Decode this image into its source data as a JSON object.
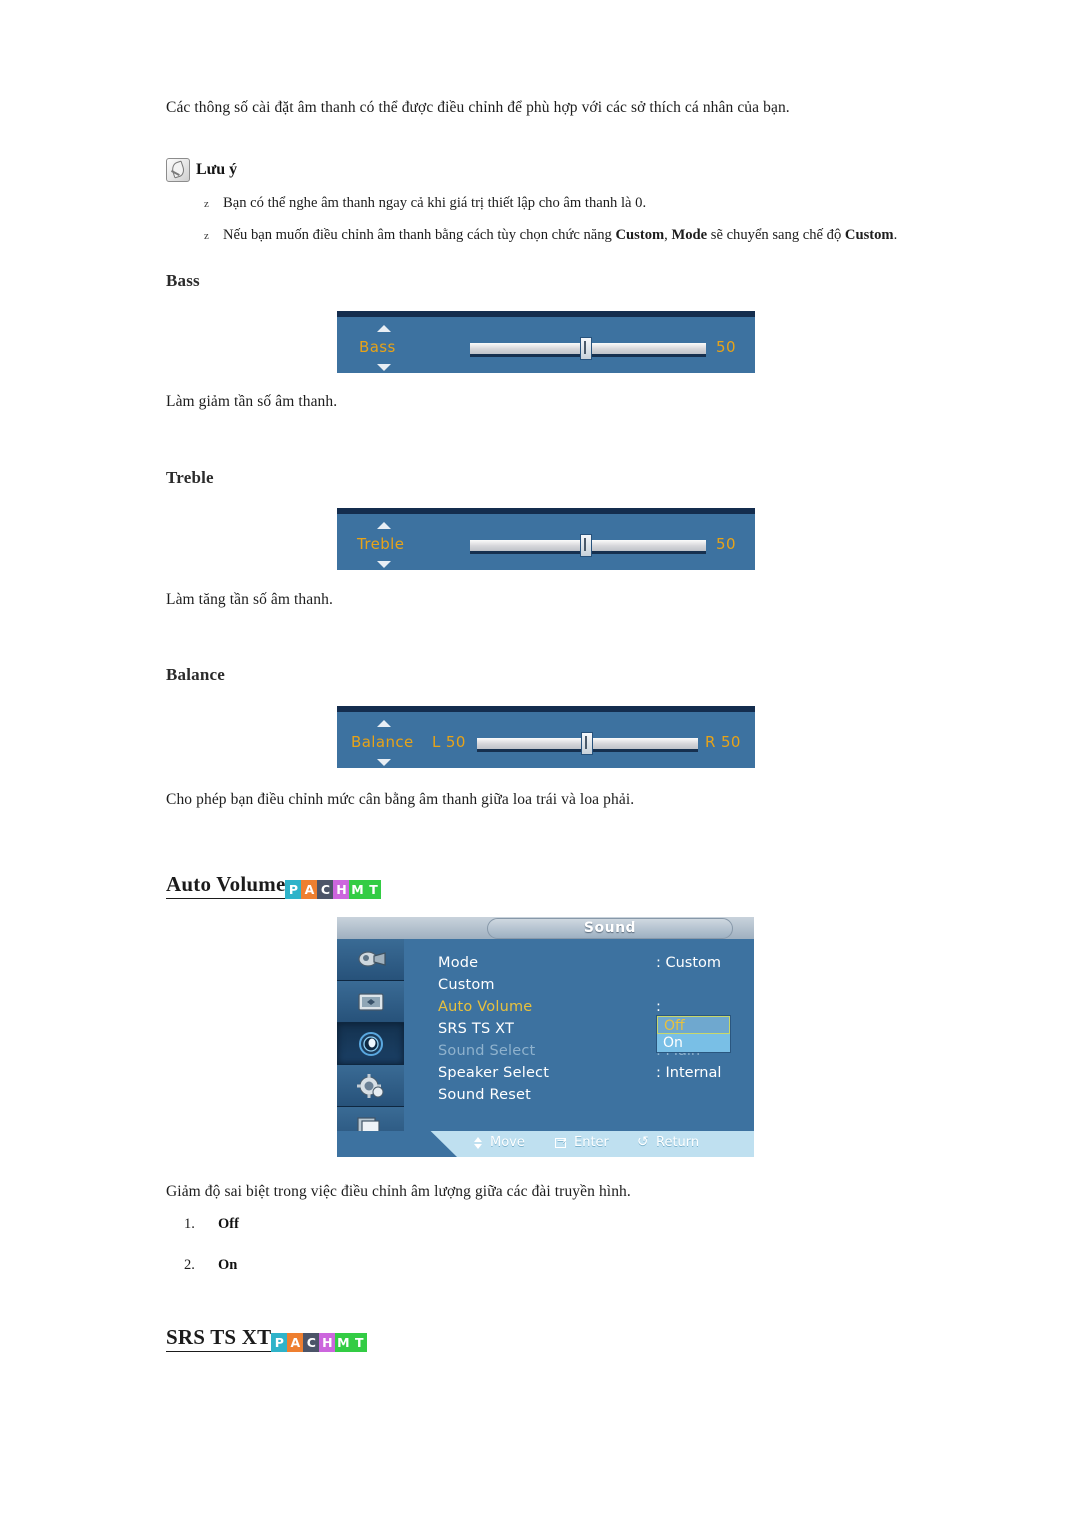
{
  "intro": "Các thông số cài đặt âm thanh có thể được điều chỉnh để phù hợp với các sở thích cá nhân của bạn.",
  "note": {
    "title": "Lưu ý",
    "bullet_marker": "z",
    "items": [
      {
        "pre": "Bạn có thể nghe âm thanh ngay cả khi giá trị thiết lập cho âm thanh là 0.",
        "parts": []
      },
      {
        "pre": "Nếu bạn muốn điều chỉnh âm thanh bằng cách tùy chọn chức năng ",
        "bold1": "Custom",
        "mid": ", ",
        "bold2": "Mode",
        "mid2": " sẽ chuyển sang chế độ ",
        "bold3": "Custom",
        "post": "."
      }
    ]
  },
  "sections": [
    {
      "heading": "Bass",
      "osd_label": "Bass",
      "value": "50",
      "description": "Làm giảm tần số âm thanh."
    },
    {
      "heading": "Treble",
      "osd_label": "Treble",
      "value": "50",
      "description": "Làm tăng tần số âm thanh."
    },
    {
      "heading": "Balance",
      "osd_label": "Balance",
      "left_label": "L  50",
      "right_label": "R  50",
      "description": "Cho phép bạn điều chỉnh mức cân bằng âm thanh giữa loa trái và loa phải."
    }
  ],
  "badge": {
    "letters": [
      "P",
      "A",
      "C",
      "H",
      "M",
      "T"
    ],
    "colors": [
      "#2fb3c9",
      "#ee7f30",
      "#4c5468",
      "#cc66dd",
      "#33cc44",
      "#33cc44"
    ]
  },
  "auto_volume": {
    "heading": "Auto Volume",
    "description": "Giảm độ sai biệt trong việc điều chỉnh âm lượng giữa các đài truyền hình.",
    "options": [
      {
        "num": "1.",
        "label": "Off"
      },
      {
        "num": "2.",
        "label": "On"
      }
    ]
  },
  "srs": {
    "heading": "SRS TS XT"
  },
  "osd_menu": {
    "title": "Sound",
    "items": [
      {
        "label": "Mode",
        "value": ": Custom",
        "state": "normal"
      },
      {
        "label": "Custom",
        "value": "",
        "state": "normal"
      },
      {
        "label": "Auto Volume",
        "value": ":",
        "state": "selected"
      },
      {
        "label": "SRS TS XT",
        "value": ":",
        "state": "normal"
      },
      {
        "label": "Sound Select",
        "value": ": Main",
        "state": "dim"
      },
      {
        "label": "Speaker Select",
        "value": ": Internal",
        "state": "normal"
      },
      {
        "label": "Sound Reset",
        "value": "",
        "state": "normal"
      }
    ],
    "dropdown": {
      "selected": "Off",
      "other": "On"
    },
    "sidebar_icons": [
      "picture-tool-icon",
      "image-icon",
      "speaker-icon",
      "gear-setup-icon",
      "multi-display-icon"
    ],
    "footer": [
      {
        "icon": "move-icon",
        "label": "Move"
      },
      {
        "icon": "enter-icon",
        "label": "Enter"
      },
      {
        "icon": "return-icon",
        "label": "Return"
      }
    ]
  }
}
